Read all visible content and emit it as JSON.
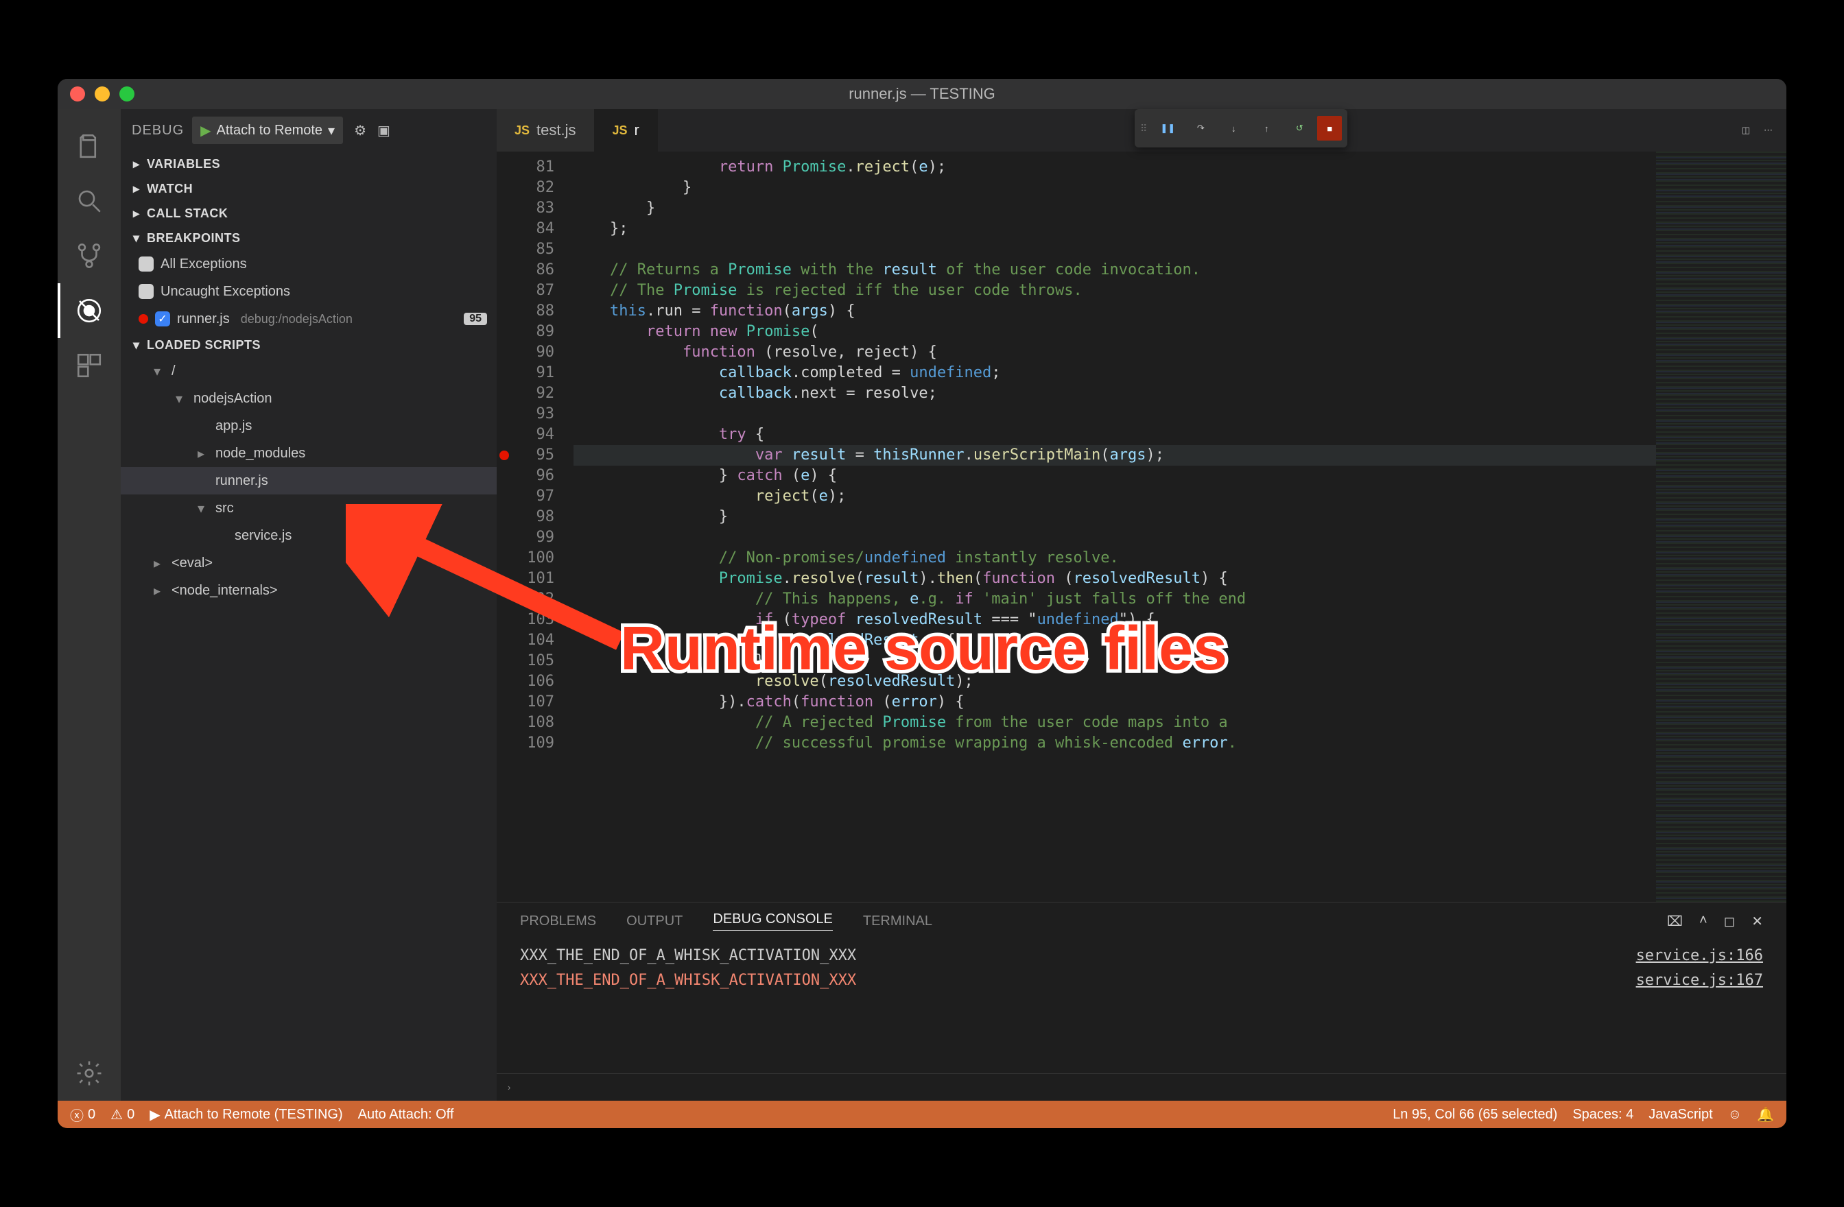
{
  "window": {
    "title": "runner.js — TESTING"
  },
  "activity": {
    "active": "debug"
  },
  "sidebar": {
    "title": "DEBUG",
    "config": "Attach to Remote",
    "sections": {
      "variables": "VARIABLES",
      "watch": "WATCH",
      "callstack": "CALL STACK",
      "breakpoints": "BREAKPOINTS",
      "loaded": "LOADED SCRIPTS"
    },
    "breakpoints": {
      "all_exceptions": "All Exceptions",
      "uncaught_exceptions": "Uncaught Exceptions",
      "items": [
        {
          "file": "runner.js",
          "path": "debug:/nodejsAction",
          "line": "95"
        }
      ]
    },
    "loaded_tree": {
      "root": "/",
      "items": [
        {
          "depth": 2,
          "label": "nodejsAction",
          "chev": "down"
        },
        {
          "depth": 3,
          "label": "app.js"
        },
        {
          "depth": 3,
          "label": "node_modules",
          "chev": "right"
        },
        {
          "depth": 3,
          "label": "runner.js",
          "selected": true
        },
        {
          "depth": 3,
          "label": "src",
          "chev": "down"
        },
        {
          "depth": 4,
          "label": "service.js"
        },
        {
          "depth": 1,
          "label": "<eval>",
          "chev": "right"
        },
        {
          "depth": 1,
          "label": "<node_internals>",
          "chev": "right"
        }
      ]
    }
  },
  "tabs": [
    {
      "name": "test.js",
      "icon": "JS",
      "active": false
    },
    {
      "name": "r",
      "icon": "JS",
      "active": true
    }
  ],
  "editor": {
    "first_line": 81,
    "breakpoint_line": 95,
    "lines": [
      "                return Promise.reject(e);",
      "            }",
      "        }",
      "    };",
      "",
      "    // Returns a Promise with the result of the user code invocation.",
      "    // The Promise is rejected iff the user code throws.",
      "    this.run = function(args) {",
      "        return new Promise(",
      "            function (resolve, reject) {",
      "                callback.completed = undefined;",
      "                callback.next = resolve;",
      "",
      "                try {",
      "                    var result = thisRunner.userScriptMain(args);",
      "                } catch (e) {",
      "                    reject(e);",
      "                }",
      "",
      "                // Non-promises/undefined instantly resolve.",
      "                Promise.resolve(result).then(function (resolvedResult) {",
      "                    // This happens, e.g. if 'main' just falls off the end",
      "                    if (typeof resolvedResult === \"undefined\") {",
      "                        resolvedResult = {};",
      "                    }",
      "                    resolve(resolvedResult);",
      "                }).catch(function (error) {",
      "                    // A rejected Promise from the user code maps into a",
      "                    // successful promise wrapping a whisk-encoded error."
    ]
  },
  "panel": {
    "tabs": {
      "problems": "PROBLEMS",
      "output": "OUTPUT",
      "debug": "DEBUG CONSOLE",
      "terminal": "TERMINAL"
    },
    "rows": [
      {
        "text": "XXX_THE_END_OF_A_WHISK_ACTIVATION_XXX",
        "src": "service.js:166",
        "err": false
      },
      {
        "text": "XXX_THE_END_OF_A_WHISK_ACTIVATION_XXX",
        "src": "service.js:167",
        "err": true
      }
    ]
  },
  "status": {
    "errors": "0",
    "warnings": "0",
    "launch": "Attach to Remote (TESTING)",
    "auto_attach": "Auto Attach: Off",
    "cursor": "Ln 95, Col 66 (65 selected)",
    "spaces": "Spaces: 4",
    "lang": "JavaScript"
  },
  "annotation": "Runtime source files"
}
